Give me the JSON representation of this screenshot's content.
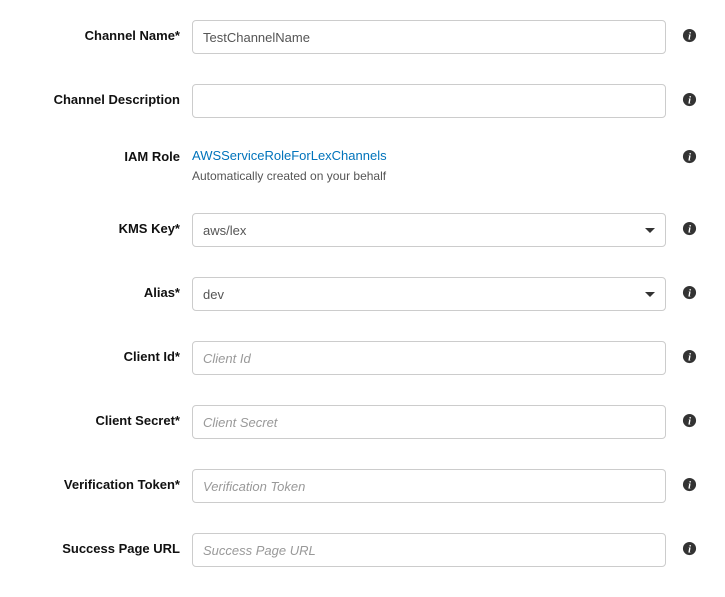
{
  "channel_name": {
    "label": "Channel Name*",
    "value": "TestChannelName"
  },
  "channel_description": {
    "label": "Channel Description",
    "value": ""
  },
  "iam_role": {
    "label": "IAM Role",
    "link_text": "AWSServiceRoleForLexChannels",
    "helper": "Automatically created on your behalf"
  },
  "kms_key": {
    "label": "KMS Key*",
    "selected": "aws/lex"
  },
  "alias": {
    "label": "Alias*",
    "selected": "dev"
  },
  "client_id": {
    "label": "Client Id*",
    "placeholder": "Client Id",
    "value": ""
  },
  "client_secret": {
    "label": "Client Secret*",
    "placeholder": "Client Secret",
    "value": ""
  },
  "verification_token": {
    "label": "Verification Token*",
    "placeholder": "Verification Token",
    "value": ""
  },
  "success_page_url": {
    "label": "Success Page URL",
    "placeholder": "Success Page URL",
    "value": ""
  }
}
